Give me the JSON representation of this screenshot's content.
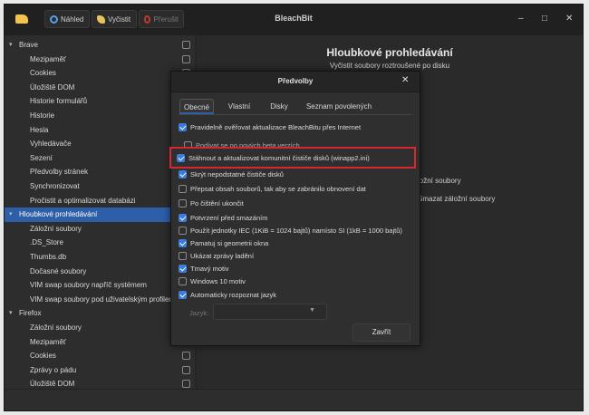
{
  "window": {
    "title": "BleachBit",
    "toolbar": {
      "preview_label": "Náhled",
      "clean_label": "Vyčistit",
      "abort_label": "Přerušit"
    },
    "controls": {
      "minimize": "–",
      "maximize": "□",
      "close": "✕"
    }
  },
  "tree": {
    "rows": [
      {
        "type": "cat",
        "label": "Brave",
        "expanded": true
      },
      {
        "type": "child",
        "label": "Mezipaměť"
      },
      {
        "type": "child",
        "label": "Cookies"
      },
      {
        "type": "child",
        "label": "Úložiště DOM"
      },
      {
        "type": "child",
        "label": "Historie formulářů"
      },
      {
        "type": "child",
        "label": "Historie"
      },
      {
        "type": "child",
        "label": "Hesla"
      },
      {
        "type": "child",
        "label": "Vyhledávače"
      },
      {
        "type": "child",
        "label": "Sezení"
      },
      {
        "type": "child",
        "label": "Předvolby stránek"
      },
      {
        "type": "child",
        "label": "Synchronizovat"
      },
      {
        "type": "child",
        "label": "Pročistit a optimalizovat databázi"
      },
      {
        "type": "cat",
        "label": "Hloubkové prohledávání",
        "selected": true,
        "expanded": true
      },
      {
        "type": "child",
        "label": "Záložní soubory"
      },
      {
        "type": "child",
        "label": ".DS_Store"
      },
      {
        "type": "child",
        "label": "Thumbs.db"
      },
      {
        "type": "child",
        "label": "Dočasné soubory"
      },
      {
        "type": "child",
        "label": "VIM swap soubory napříč systémem"
      },
      {
        "type": "child",
        "label": "VIM swap soubory pod uživatelským profilem"
      },
      {
        "type": "cat",
        "label": "Firefox",
        "expanded": true
      },
      {
        "type": "child",
        "label": "Záložní soubory"
      },
      {
        "type": "child",
        "label": "Mezipaměť"
      },
      {
        "type": "child",
        "label": "Cookies"
      },
      {
        "type": "child",
        "label": "Zprávy o pádu"
      },
      {
        "type": "child",
        "label": "Úložiště DOM"
      }
    ]
  },
  "right_pane": {
    "title": "Hloubkové prohledávání",
    "subtitle": "Vyčistit soubory roztroušené po disku",
    "partial_texts": [
      "ložní soubory",
      "Smazat záložní soubory"
    ]
  },
  "dialog": {
    "title": "Předvolby",
    "close_icon": "✕",
    "tabs": [
      "Obecné",
      "Vlastní",
      "Disky",
      "Seznam povolených"
    ],
    "active_tab": 0,
    "options": [
      {
        "label": "Pravidelně ověřovat aktualizace BleachBitu přes Internet",
        "checked": true,
        "indent": false
      },
      {
        "label": "Podívat se po nových beta verzích",
        "checked": false,
        "indent": true
      },
      {
        "label": "Stáhnout a aktualizovat komunitní čističe disků (winapp2.ini)",
        "checked": true,
        "indent": true,
        "highlighted": true
      },
      {
        "label": "Skrýt nepodstatné čističe disků",
        "checked": true,
        "indent": false
      },
      {
        "label": "Přepsat obsah souborů, tak aby se zabránilo obnovení dat",
        "checked": false,
        "indent": false
      },
      {
        "label": "Po čištění ukončit",
        "checked": false,
        "indent": false
      },
      {
        "label": "Potvrzení před smazáním",
        "checked": true,
        "indent": false
      },
      {
        "label": "Použít jednotky IEC (1KiB = 1024 bajtů) namísto SI (1kB = 1000 bajtů)",
        "checked": false,
        "indent": false
      },
      {
        "label": "Pamatuj si geometrii okna",
        "checked": true,
        "indent": false
      },
      {
        "label": "Ukázat zprávy ladění",
        "checked": false,
        "indent": false
      },
      {
        "label": "Tmavý motiv",
        "checked": true,
        "indent": false
      },
      {
        "label": "Windows 10 motiv",
        "checked": false,
        "indent": false
      },
      {
        "label": "Automaticky rozpoznat jazyk",
        "checked": true,
        "indent": false
      }
    ],
    "language_label": "Jazyk:",
    "language_value": "",
    "close_button": "Zavřít"
  },
  "colors": {
    "accent": "#3b7ddd",
    "selection": "#2d5ea8",
    "highlight_box": "#d7282f",
    "background": "#2d2d2d"
  },
  "icons": {
    "preview": "preview-icon",
    "clean": "clean-icon",
    "abort": "abort-icon",
    "app": "bleachbit-app-icon",
    "dropdown": "chevron-down-icon"
  }
}
